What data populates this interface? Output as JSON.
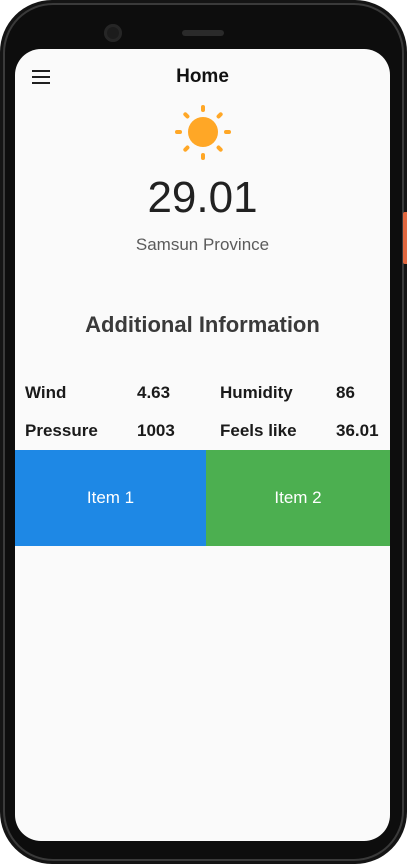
{
  "appbar": {
    "title": "Home",
    "menu_icon": "hamburger-menu-icon"
  },
  "weather": {
    "icon": "sun-icon",
    "icon_color": "#ffa726",
    "temperature": "29.01",
    "location": "Samsun Province"
  },
  "additional": {
    "heading": "Additional Information",
    "wind_label": "Wind",
    "wind_value": "4.63",
    "humidity_label": "Humidity",
    "humidity_value": "86",
    "pressure_label": "Pressure",
    "pressure_value": "1003",
    "feels_like_label": "Feels like",
    "feels_like_value": "36.01"
  },
  "tiles": [
    {
      "label": "Item 1",
      "color": "#1e88e5"
    },
    {
      "label": "Item 2",
      "color": "#4caf50"
    }
  ]
}
